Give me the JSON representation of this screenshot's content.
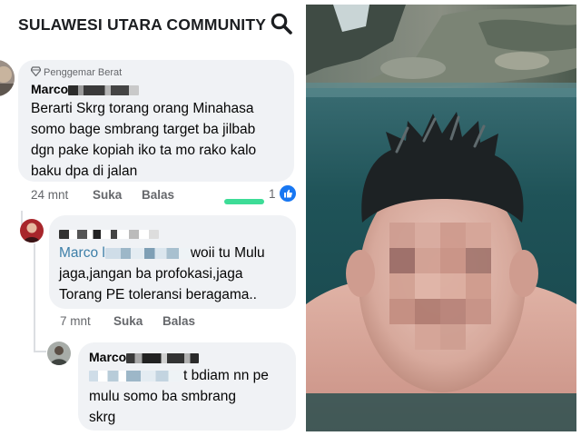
{
  "header": {
    "group_title": "SULAWESI UTARA COMMUNITY",
    "search_icon": "search-icon"
  },
  "comments": [
    {
      "badge": "Penggemar Berat",
      "author_visible": "Marco",
      "text_lines": [
        "Berarti Skrg torang orang Minahasa",
        "somo bage smbrang target ba jilbab",
        "dgn pake kopiah iko ta mo rako kalo",
        "baku dpa di jalan"
      ],
      "time": "24 mnt",
      "like_label": "Suka",
      "reply_label": "Balas",
      "reaction_count": "1",
      "reaction_icon": "like-icon"
    },
    {
      "mention_visible": "Marco l",
      "text_lines": [
        "woii tu Mulu",
        "jaga,jangan ba profokasi,jaga",
        "Torang PE toleransi beragama.."
      ],
      "time": "7 mnt",
      "like_label": "Suka",
      "reply_label": "Balas"
    },
    {
      "author_visible": "Marco",
      "text_lines": [
        "t bdiam nn pe",
        "mulu  somo ba smbrang",
        "skrg"
      ]
    }
  ],
  "colors": {
    "bubble": "#f0f2f5",
    "meta_text": "#65676b",
    "like_blue": "#1877f2",
    "mention": "#3d7fa8",
    "highlight": "#3ddc97"
  }
}
